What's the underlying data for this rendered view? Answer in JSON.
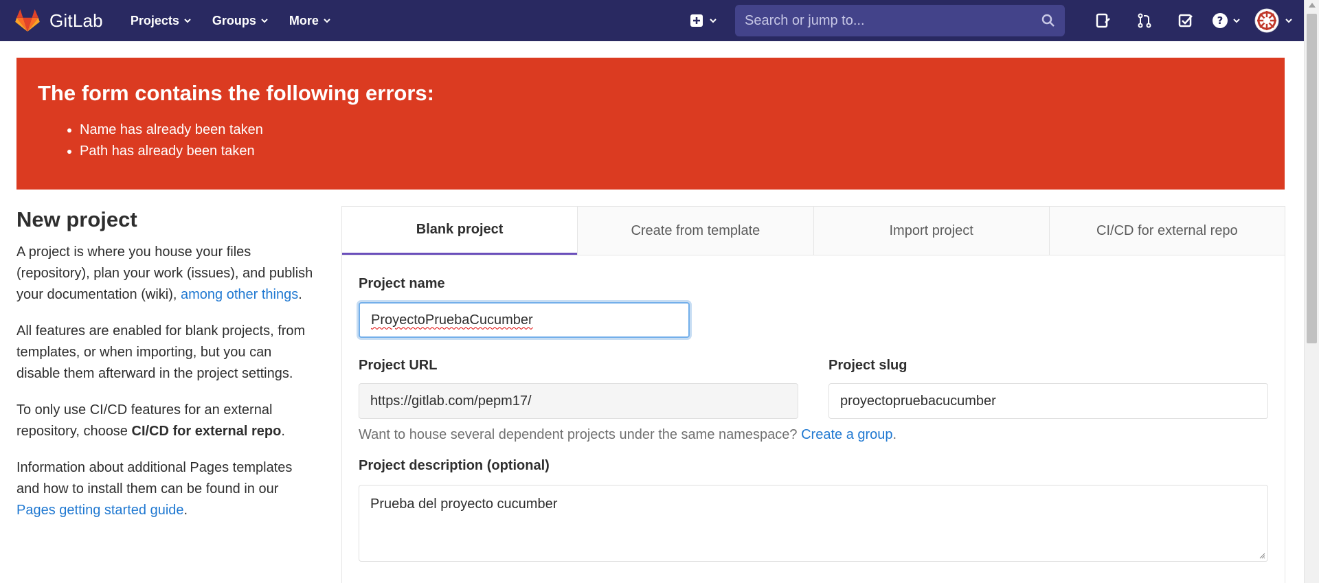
{
  "nav": {
    "brand": "GitLab",
    "menu": [
      "Projects",
      "Groups",
      "More"
    ],
    "search_placeholder": "Search or jump to...",
    "icons": [
      "plus-square-icon",
      "chevron-down-icon",
      "search-icon",
      "issues-icon",
      "merge-request-icon",
      "todo-icon",
      "help-icon",
      "avatar"
    ]
  },
  "errors": {
    "title": "The form contains the following errors:",
    "items": [
      "Name has already been taken",
      "Path has already been taken"
    ],
    "color": "#db3b21"
  },
  "sidebar": {
    "title": "New project",
    "p1_text": "A project is where you house your files (repository), plan your work (issues), and publish your documentation (wiki), ",
    "p1_link": "among other things",
    "p1_end": ".",
    "p2": "All features are enabled for blank projects, from templates, or when importing, but you can disable them afterward in the project settings.",
    "p3_text": "To only use CI/CD features for an external repository, choose ",
    "p3_bold": "CI/CD for external repo",
    "p3_end": ".",
    "p4_text": "Information about additional Pages templates and how to install them can be found in our ",
    "p4_link": "Pages getting started guide",
    "p4_end": "."
  },
  "tabs": [
    {
      "label": "Blank project",
      "active": true
    },
    {
      "label": "Create from template",
      "active": false
    },
    {
      "label": "Import project",
      "active": false
    },
    {
      "label": "CI/CD for external repo",
      "active": false
    }
  ],
  "form": {
    "name_label": "Project name",
    "name_value": "ProyectoPruebaCucumber",
    "url_label": "Project URL",
    "url_value": "https://gitlab.com/pepm17/",
    "slug_label": "Project slug",
    "slug_value": "proyectopruebacucumber",
    "help_text": "Want to house several dependent projects under the same namespace? ",
    "help_link": "Create a group",
    "help_end": ".",
    "desc_label": "Project description (optional)",
    "desc_value": "Prueba del proyecto cucumber"
  },
  "colors": {
    "navbar": "#292961",
    "link": "#1f78d1",
    "active_tab_border": "#6b4fbb"
  }
}
